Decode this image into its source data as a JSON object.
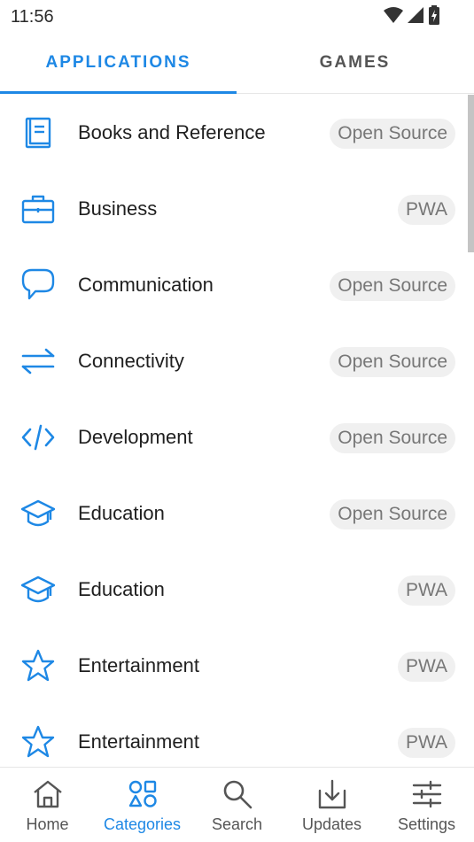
{
  "status_bar": {
    "time": "11:56"
  },
  "tabs": {
    "applications": "APPLICATIONS",
    "games": "GAMES",
    "active": "applications"
  },
  "categories": [
    {
      "label": "Books and Reference",
      "badge": "Open Source",
      "icon": "book-icon"
    },
    {
      "label": "Business",
      "badge": "PWA",
      "icon": "briefcase-icon"
    },
    {
      "label": "Communication",
      "badge": "Open Source",
      "icon": "chat-bubble-icon"
    },
    {
      "label": "Connectivity",
      "badge": "Open Source",
      "icon": "swap-arrows-icon"
    },
    {
      "label": "Development",
      "badge": "Open Source",
      "icon": "code-icon"
    },
    {
      "label": "Education",
      "badge": "Open Source",
      "icon": "graduation-cap-icon"
    },
    {
      "label": "Education",
      "badge": "PWA",
      "icon": "graduation-cap-icon"
    },
    {
      "label": "Entertainment",
      "badge": "PWA",
      "icon": "star-icon"
    },
    {
      "label": "Entertainment",
      "badge": "PWA",
      "icon": "star-icon"
    }
  ],
  "bottom_nav": {
    "home": "Home",
    "categories": "Categories",
    "search": "Search",
    "updates": "Updates",
    "settings": "Settings",
    "active": "categories"
  },
  "colors": {
    "accent": "#1e88e5",
    "badge_bg": "#f0f0f0",
    "text": "#1f1f1f",
    "muted": "#555555"
  }
}
